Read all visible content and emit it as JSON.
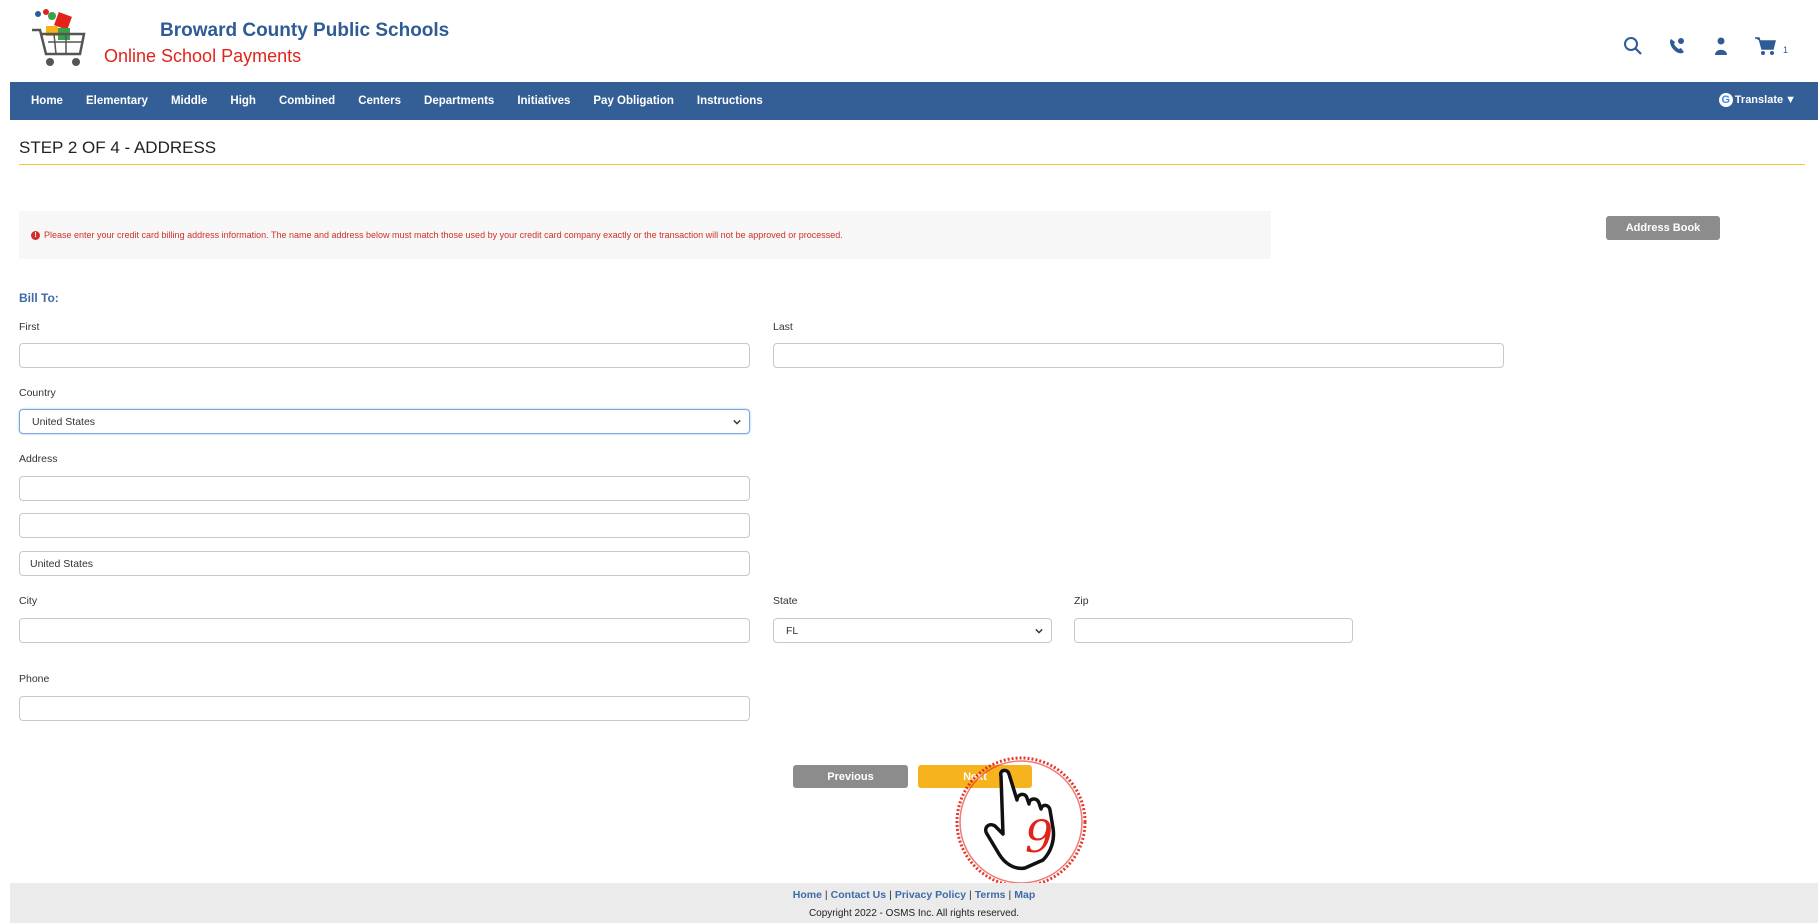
{
  "brand": {
    "title": "Broward County Public Schools",
    "subtitle": "Online School Payments"
  },
  "header": {
    "icons": [
      "search-icon",
      "phone-icon",
      "user-icon",
      "cart-icon"
    ],
    "cart_count": "1"
  },
  "nav": {
    "items": [
      "Home",
      "Elementary",
      "Middle",
      "High",
      "Combined",
      "Centers",
      "Departments",
      "Initiatives",
      "Pay Obligation",
      "Instructions"
    ],
    "translate": "Translate"
  },
  "step": {
    "title": "STEP 2 OF 4 - ADDRESS"
  },
  "alert": {
    "text": "Please enter your credit card billing address information. The name and address below must match those used by your credit card company exactly or the transaction will not be approved or processed."
  },
  "address_book": "Address Book",
  "form": {
    "section_title": "Bill To:",
    "first_label": "First",
    "first_value": "",
    "last_label": "Last",
    "last_value": "",
    "country_label": "Country",
    "country_value": "United States",
    "address_label": "Address",
    "address1_value": "",
    "address2_value": "",
    "address3_value": "United States",
    "city_label": "City",
    "city_value": "",
    "state_label": "State",
    "state_value": "FL",
    "zip_label": "Zip",
    "zip_value": "",
    "phone_label": "Phone",
    "phone_value": ""
  },
  "buttons": {
    "previous": "Previous",
    "next": "Next"
  },
  "footer": {
    "links": [
      "Home",
      "Contact Us",
      "Privacy Policy",
      "Terms",
      "Map"
    ],
    "copyright": "Copyright 2022 - OSMS Inc. All rights reserved."
  },
  "colors": {
    "nav_bg": "#335e96",
    "brand_blue": "#2f5b96",
    "brand_red": "#e2231a",
    "accent_yellow": "#f7b31e",
    "alert_red": "#d0302b"
  }
}
